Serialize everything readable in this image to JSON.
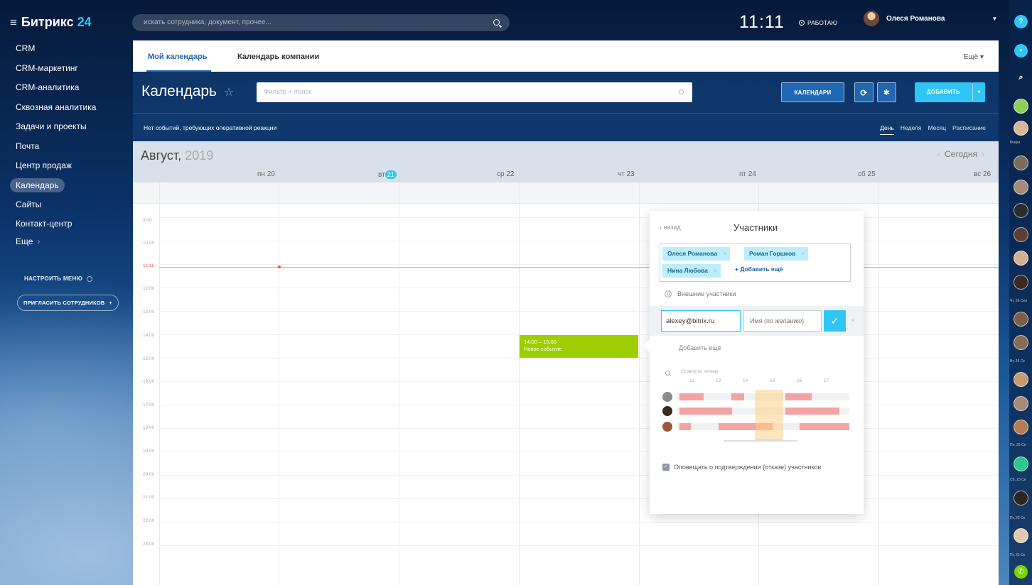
{
  "app": {
    "logo_brand": "Битрикс",
    "logo_num": "24"
  },
  "search": {
    "placeholder": "искать сотрудника, документ, прочее..."
  },
  "header": {
    "time": "11:11",
    "status": "РАБОТАЮ",
    "user_name": "Олеся Романова"
  },
  "sidebar": {
    "items": [
      {
        "label": "CRM"
      },
      {
        "label": "CRM-маркетинг"
      },
      {
        "label": "CRM-аналитика"
      },
      {
        "label": "Сквозная аналитика"
      },
      {
        "label": "Задачи и проекты"
      },
      {
        "label": "Почта"
      },
      {
        "label": "Центр продаж"
      },
      {
        "label": "Календарь",
        "active": true
      },
      {
        "label": "Сайты"
      },
      {
        "label": "Контакт-центр"
      }
    ],
    "more": "Еще",
    "customize": "НАСТРОИТЬ МЕНЮ",
    "invite": "ПРИГЛАСИТЬ СОТРУДНИКОВ"
  },
  "tabs": {
    "my": "Мой календарь",
    "company": "Календарь компании",
    "more": "Ещё"
  },
  "toolbar": {
    "title": "Календарь",
    "filter_placeholder": "Фильтр + поиск",
    "calendars": "КАЛЕНДАРИ",
    "add": "ДОБАВИТЬ"
  },
  "infobar": {
    "no_events": "Нет событий, требующих оперативной реакции"
  },
  "views": [
    "День",
    "Неделя",
    "Месяц",
    "Расписание"
  ],
  "calendar": {
    "month": "Август,",
    "year": "2019",
    "today": "Сегодня",
    "days": [
      {
        "name": "пн",
        "num": "20"
      },
      {
        "name": "вт",
        "num": "21",
        "today": true
      },
      {
        "name": "ср",
        "num": "22"
      },
      {
        "name": "чт",
        "num": "23"
      },
      {
        "name": "пт",
        "num": "24"
      },
      {
        "name": "сб",
        "num": "25"
      },
      {
        "name": "вс",
        "num": "26"
      }
    ],
    "times": [
      "9:00",
      "10:00",
      "11:11",
      "12:00",
      "13:00",
      "14:00",
      "15:00",
      "16:00",
      "17:00",
      "18:00",
      "19:00",
      "20:00",
      "21:00",
      "22:00",
      "23:00"
    ],
    "event": {
      "time": "14:00 – 15:00",
      "title": "Новое событие"
    }
  },
  "popup": {
    "back": "назад",
    "title": "Участники",
    "participants": [
      "Олеся Романова",
      "Роман Горшков",
      "Нина Любова"
    ],
    "add_more": "+ Добавить ещё",
    "external": "Внешние участники",
    "email_value": "alexey@bitrix.ru",
    "name_placeholder": "Имя (по желанию)",
    "add_more_ext": "Добавить ещё",
    "planner_date": "23 августа, четверг",
    "hours": [
      "12",
      "13",
      "14",
      "15",
      "16",
      "17"
    ],
    "notify": "Оповещать о подтверждении (отказе) участников"
  },
  "rightbar": {
    "labels": [
      "Вчера",
      "Чт, 26 Сен",
      "Вт, 26 Се",
      "Пн, 25 Се",
      "Сб, 23 Се",
      "Пт, 22 Се",
      "Пт, 21 Се"
    ]
  },
  "colors": {
    "accent": "#2fc6f6",
    "primary": "#2067b0",
    "event": "#9dcf00",
    "busy": "#f4a3a3"
  }
}
